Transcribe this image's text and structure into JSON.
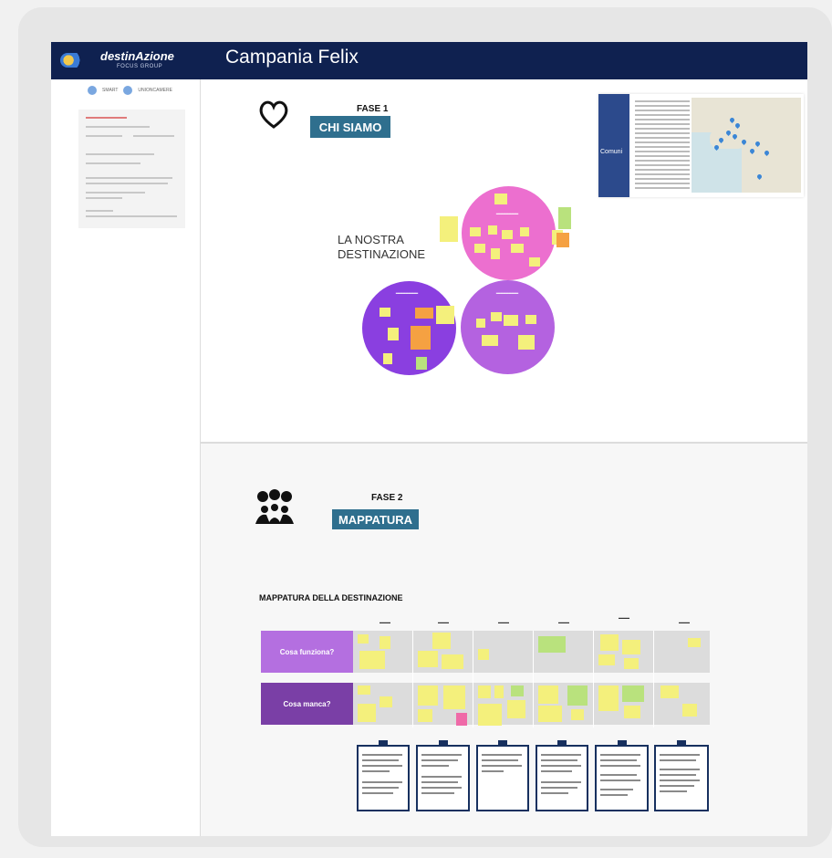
{
  "header": {
    "logo": "destinAzione",
    "logo_sub": "FOCUS GROUP",
    "title": "Campania Felix"
  },
  "sidebar": {
    "partner1": "SMART",
    "partner2": "UNIONCAMERE"
  },
  "phase1": {
    "label": "FASE 1",
    "pill": "CHI SIAMO",
    "comuni_label": "Comuni",
    "destination_title_line1": "LA NOSTRA",
    "destination_title_line2": "DESTINAZIONE"
  },
  "phase2": {
    "label": "FASE 2",
    "pill": "MAPPATURA",
    "mapping_title": "MAPPATURA DELLA DESTINAZIONE",
    "rows": [
      "Cosa funziona?",
      "Cosa manca?"
    ]
  },
  "colors": {
    "header": "#0f2150",
    "pill": "#2f6f8e",
    "bubble_pink": "#ec6fcf",
    "bubble_purple": "#8a3fe0",
    "bubble_violet": "#b462e0",
    "row_works": "#b46fe0",
    "row_missing": "#7a3fa6",
    "note_yellow": "#f4f07c",
    "note_green": "#b9e27d",
    "note_orange": "#f5a142"
  }
}
